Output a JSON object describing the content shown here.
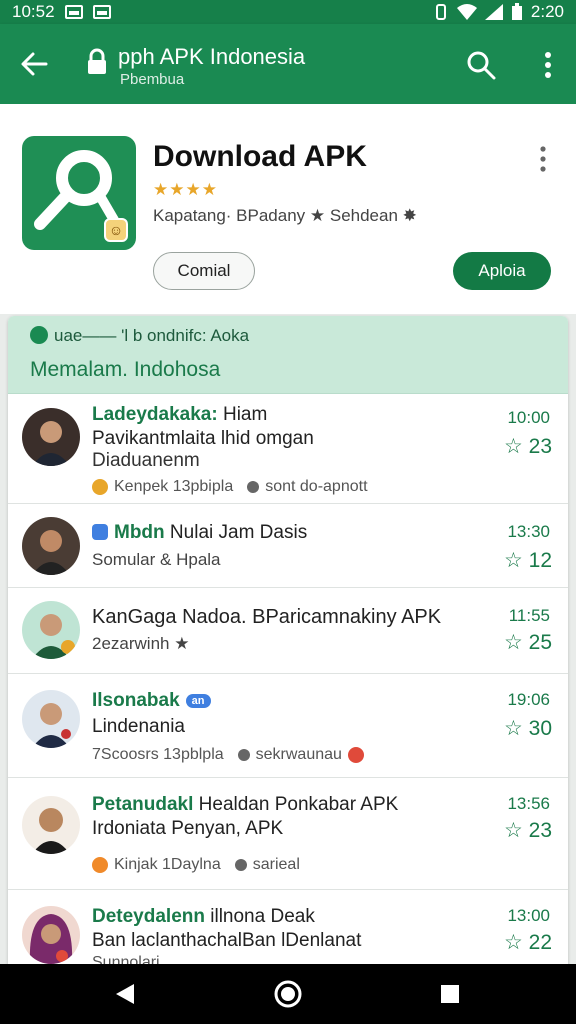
{
  "status_bar": {
    "time_left": "10:52",
    "time_right": "2:20"
  },
  "app_bar": {
    "title": "pph APK Indonesia",
    "subtitle": "Pbembua",
    "icons": [
      "back-arrow-icon",
      "lock-icon",
      "search-icon",
      "more-vert-icon"
    ]
  },
  "app_header": {
    "title": "Download APK",
    "stars": "★★★★",
    "meta": "Kapatang· BPadany ★ Sehdean ✸",
    "secondary_button": "Comial",
    "primary_button": "Aploia",
    "icon_badge": "☺",
    "accent_color": "#1a8a52"
  },
  "banner": {
    "line1": "uae—— 'l b ondnifc: Aoka",
    "line2": "Memalam. Indohosa"
  },
  "list": [
    {
      "name": "Ladeydakaka:",
      "name_rest": " Hiam",
      "line2": "Pavikantmlaita lhid omgan",
      "line3": "Diaduanenm",
      "meta1": "Kenpek 13pbipla",
      "meta2": "sont do-apnott",
      "time": "10:00",
      "score": "23"
    },
    {
      "name": "Mbdn",
      "name_rest": " Nulai Jam Dasis",
      "line2": "Somular & Hpala",
      "line3": "",
      "meta1": "",
      "meta2": "",
      "time": "13:30",
      "score": "12"
    },
    {
      "name": "",
      "name_rest": "KanGaga Nadoa. BParicamnakiny APK",
      "line2": "2ezarwinh ★",
      "line3": "",
      "meta1": "",
      "meta2": "",
      "time": "11:55",
      "score": "25"
    },
    {
      "name": "Ilsonabak",
      "name_rest": "",
      "tag": "an",
      "line2": "Lindenania",
      "line3": "",
      "meta1": "7Scoosrs 13pblpla",
      "meta2": "sekrwaunau",
      "time": "19:06",
      "score": "30"
    },
    {
      "name": "Petanudakl",
      "name_rest": " Healdan Ponkabar APK",
      "line2": "Irdoniata Penyan, APK",
      "line3": "",
      "meta1": "Kinjak 1Daylna",
      "meta2": "sarieal",
      "time": "13:56",
      "score": "23"
    },
    {
      "name": "Deteydalenn",
      "name_rest": " illnona Deak",
      "line2": "Ban laclanthachalBan lDenlanat",
      "line3": "Sunnolari",
      "meta1": "",
      "meta2": "",
      "time": "13:00",
      "score": "22"
    }
  ],
  "nav_bar": {
    "icons": [
      "back-triangle-icon",
      "home-circle-icon",
      "recents-square-icon"
    ]
  }
}
